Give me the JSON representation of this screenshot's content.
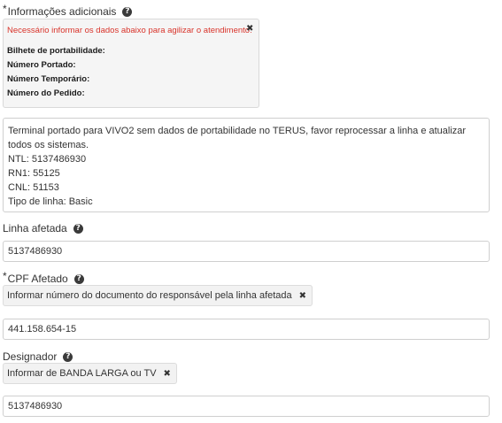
{
  "info_section": {
    "required_mark": "*",
    "label": "Informações adicionais",
    "help_icon": "question-circle-icon",
    "warning": "Necessário informar os dados abaixo para agilizar o atendimento:",
    "close_icon": "close-icon",
    "lines": [
      "Bilhete de portabilidade:",
      "Número Portado:",
      "Número Temporário:",
      "Número do Pedido:"
    ]
  },
  "description": {
    "lines": [
      "Terminal portado para VIVO2 sem dados de portabilidade no TERUS, favor reprocessar a linha e atualizar todos os sistemas.",
      "NTL: 5137486930",
      "RN1: 55125",
      "CNL: 51153",
      "Tipo de linha: Basic"
    ]
  },
  "linha_afetada": {
    "label": "Linha afetada",
    "help_icon": "question-circle-icon",
    "value": "5137486930"
  },
  "cpf_afetado": {
    "required_mark": "*",
    "label": "CPF Afetado",
    "help_icon": "question-circle-icon",
    "note": "Informar número do documento do responsável pela linha afetada",
    "close_icon": "close-icon",
    "value": "441.158.654-15"
  },
  "designador": {
    "label": "Designador",
    "help_icon": "question-circle-icon",
    "note": "Informar de BANDA LARGA ou TV",
    "close_icon": "close-icon",
    "value": "5137486930"
  }
}
